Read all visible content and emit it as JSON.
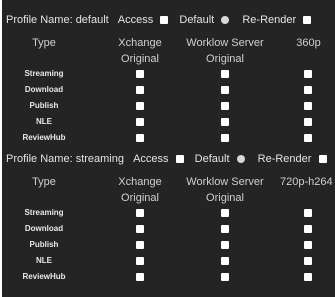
{
  "profiles": [
    {
      "name_label": "Profile Name: default",
      "access_label": "Access",
      "default_label": "Default",
      "rerender_label": "Re-Render",
      "columns": {
        "type": "Type",
        "xchange": "Xchange",
        "xchange_sub": "Original",
        "worklow": "Worklow Server",
        "worklow_sub": "Original",
        "resolution": "360p"
      },
      "rows": [
        "Streaming",
        "Download",
        "Publish",
        "NLE",
        "ReviewHub"
      ]
    },
    {
      "name_label": "Profile Name: streaming",
      "access_label": "Access",
      "default_label": "Default",
      "rerender_label": "Re-Render",
      "columns": {
        "type": "Type",
        "xchange": "Xchange",
        "xchange_sub": "Original",
        "worklow": "Worklow Server",
        "worklow_sub": "Original",
        "resolution": "720p-h264"
      },
      "rows": [
        "Streaming",
        "Download",
        "Publish",
        "NLE",
        "ReviewHub"
      ]
    }
  ]
}
